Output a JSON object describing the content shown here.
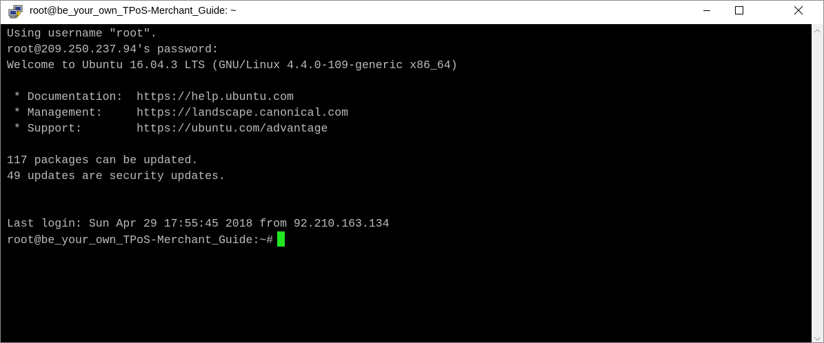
{
  "window": {
    "title": "root@be_your_own_TPoS-Merchant_Guide: ~",
    "app_icon": "putty-icon",
    "controls": {
      "minimize_icon": "minimize-icon",
      "maximize_icon": "maximize-icon",
      "close_icon": "close-icon"
    }
  },
  "terminal": {
    "lines": [
      "Using username \"root\".",
      "root@209.250.237.94's password:",
      "Welcome to Ubuntu 16.04.3 LTS (GNU/Linux 4.4.0-109-generic x86_64)",
      "",
      " * Documentation:  https://help.ubuntu.com",
      " * Management:     https://landscape.canonical.com",
      " * Support:        https://ubuntu.com/advantage",
      "",
      "117 packages can be updated.",
      "49 updates are security updates.",
      "",
      "",
      "Last login: Sun Apr 29 17:55:45 2018 from 92.210.163.134"
    ],
    "prompt": "root@be_your_own_TPoS-Merchant_Guide:~#",
    "colors": {
      "background": "#000000",
      "text": "#bbbbbb",
      "cursor": "#22e622"
    }
  },
  "scrollbar": {
    "up_icon": "scroll-up-arrow-icon",
    "down_icon": "scroll-down-arrow-icon"
  }
}
